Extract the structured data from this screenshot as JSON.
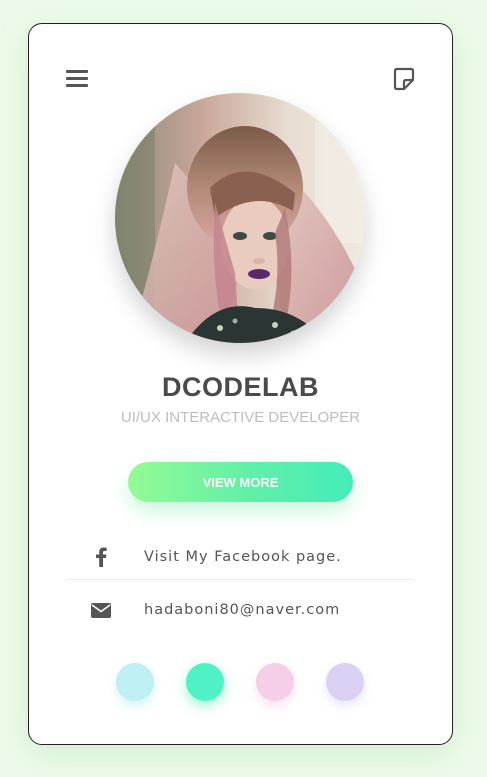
{
  "profile": {
    "name": "DCODELAB",
    "role": "UI/UX INTERACTIVE DEVELOPER"
  },
  "actions": {
    "view_more_label": "VIEW MORE"
  },
  "contacts": [
    {
      "icon": "facebook-icon",
      "text": "Visit My Facebook page."
    },
    {
      "icon": "mail-icon",
      "text": "hadaboni80@naver.com"
    }
  ],
  "theme_dots": [
    {
      "color": "#bdeff3"
    },
    {
      "color": "#4ff2c4"
    },
    {
      "color": "#f5cfe8"
    },
    {
      "color": "#d9d0f3"
    }
  ],
  "icons": {
    "menu": "hamburger-menu-icon",
    "note": "note-icon"
  }
}
